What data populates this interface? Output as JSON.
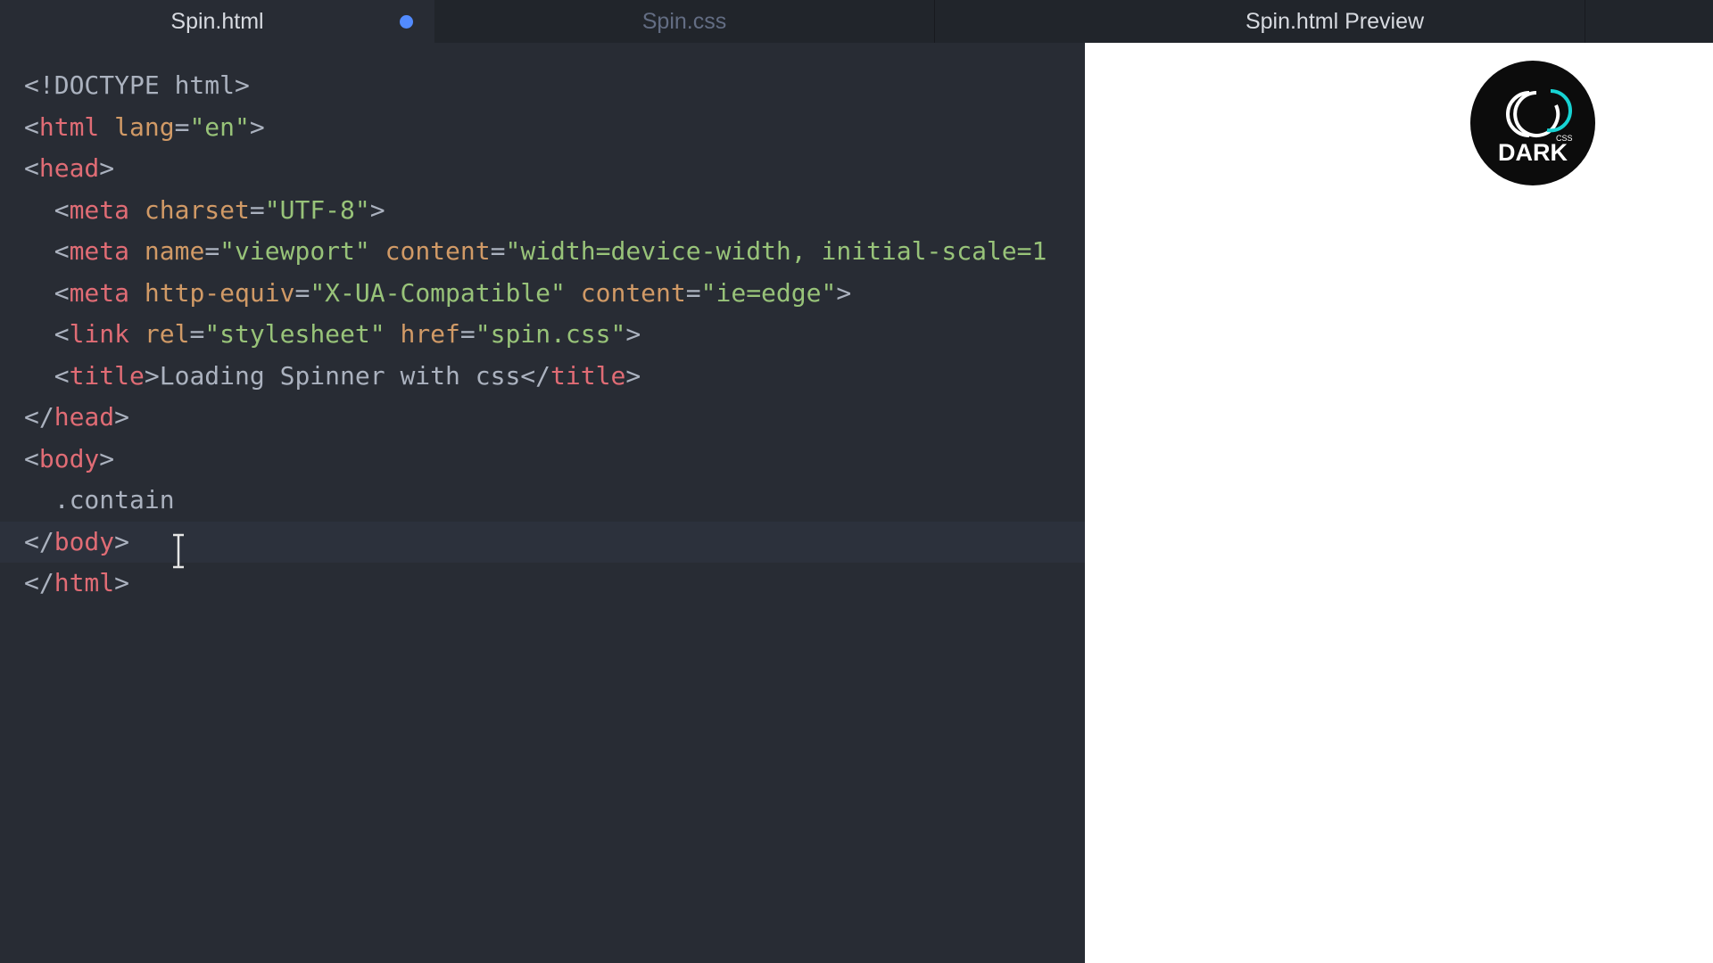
{
  "tabs": [
    {
      "label": "Spin.html",
      "active": true,
      "modified": true
    },
    {
      "label": "Spin.css",
      "active": false
    },
    {
      "label": "Spin.html Preview",
      "active": false
    }
  ],
  "editor": {
    "lines": [
      [
        {
          "t": "<!DOCTYPE html>",
          "c": "punct"
        }
      ],
      [
        {
          "t": "<",
          "c": "punct"
        },
        {
          "t": "html",
          "c": "tag"
        },
        {
          "t": " ",
          "c": "punct"
        },
        {
          "t": "lang",
          "c": "attr"
        },
        {
          "t": "=",
          "c": "punct"
        },
        {
          "t": "\"en\"",
          "c": "str"
        },
        {
          "t": ">",
          "c": "punct"
        }
      ],
      [
        {
          "t": "<",
          "c": "punct"
        },
        {
          "t": "head",
          "c": "tag"
        },
        {
          "t": ">",
          "c": "punct"
        }
      ],
      [
        {
          "t": "  <",
          "c": "punct"
        },
        {
          "t": "meta",
          "c": "tag"
        },
        {
          "t": " ",
          "c": "punct"
        },
        {
          "t": "charset",
          "c": "attr"
        },
        {
          "t": "=",
          "c": "punct"
        },
        {
          "t": "\"UTF-8\"",
          "c": "str"
        },
        {
          "t": ">",
          "c": "punct"
        }
      ],
      [
        {
          "t": "  <",
          "c": "punct"
        },
        {
          "t": "meta",
          "c": "tag"
        },
        {
          "t": " ",
          "c": "punct"
        },
        {
          "t": "name",
          "c": "attr"
        },
        {
          "t": "=",
          "c": "punct"
        },
        {
          "t": "\"viewport\"",
          "c": "str"
        },
        {
          "t": " ",
          "c": "punct"
        },
        {
          "t": "content",
          "c": "attr"
        },
        {
          "t": "=",
          "c": "punct"
        },
        {
          "t": "\"width=device-width, initial-scale=1",
          "c": "str"
        }
      ],
      [
        {
          "t": "  <",
          "c": "punct"
        },
        {
          "t": "meta",
          "c": "tag"
        },
        {
          "t": " ",
          "c": "punct"
        },
        {
          "t": "http-equiv",
          "c": "attr"
        },
        {
          "t": "=",
          "c": "punct"
        },
        {
          "t": "\"X-UA-Compatible\"",
          "c": "str"
        },
        {
          "t": " ",
          "c": "punct"
        },
        {
          "t": "content",
          "c": "attr"
        },
        {
          "t": "=",
          "c": "punct"
        },
        {
          "t": "\"ie=edge\"",
          "c": "str"
        },
        {
          "t": ">",
          "c": "punct"
        }
      ],
      [
        {
          "t": "  <",
          "c": "punct"
        },
        {
          "t": "link",
          "c": "tag"
        },
        {
          "t": " ",
          "c": "punct"
        },
        {
          "t": "rel",
          "c": "attr"
        },
        {
          "t": "=",
          "c": "punct"
        },
        {
          "t": "\"stylesheet\"",
          "c": "str"
        },
        {
          "t": " ",
          "c": "punct"
        },
        {
          "t": "href",
          "c": "attr"
        },
        {
          "t": "=",
          "c": "punct"
        },
        {
          "t": "\"spin.css\"",
          "c": "str"
        },
        {
          "t": ">",
          "c": "punct"
        }
      ],
      [
        {
          "t": "  <",
          "c": "punct"
        },
        {
          "t": "title",
          "c": "tag"
        },
        {
          "t": ">Loading Spinner with css</",
          "c": "punct"
        },
        {
          "t": "title",
          "c": "tag"
        },
        {
          "t": ">",
          "c": "punct"
        }
      ],
      [
        {
          "t": "</",
          "c": "punct"
        },
        {
          "t": "head",
          "c": "tag"
        },
        {
          "t": ">",
          "c": "punct"
        }
      ],
      [
        {
          "t": "<",
          "c": "punct"
        },
        {
          "t": "body",
          "c": "tag"
        },
        {
          "t": ">",
          "c": "punct"
        }
      ],
      [
        {
          "t": "  .contain",
          "c": "punct"
        }
      ],
      [
        {
          "t": "</",
          "c": "punct"
        },
        {
          "t": "body",
          "c": "tag"
        },
        {
          "t": ">",
          "c": "punct"
        }
      ],
      [
        {
          "t": "</",
          "c": "punct"
        },
        {
          "t": "html",
          "c": "tag"
        },
        {
          "t": ">",
          "c": "punct"
        }
      ]
    ],
    "active_line": 11
  },
  "logo": {
    "text": "DARK",
    "sub": "CSS"
  },
  "colors": {
    "editor_bg": "#282c34",
    "tag": "#e06c75",
    "attr": "#d19a66",
    "string": "#98c379",
    "text": "#abb2bf",
    "modified_dot": "#528bff",
    "logo_accent": "#17d3d3"
  },
  "icons": {
    "cursor": "text-cursor-icon",
    "modified": "modified-dot-icon"
  }
}
